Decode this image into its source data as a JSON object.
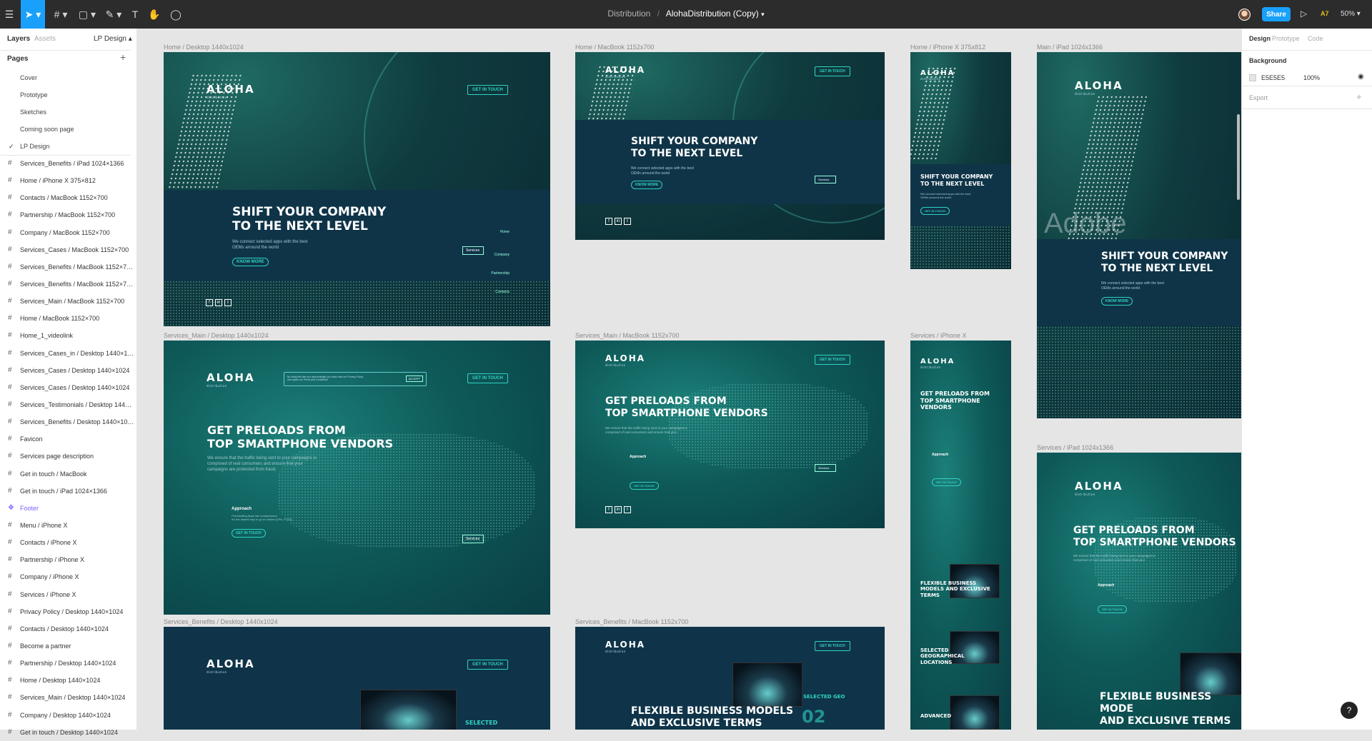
{
  "toolbar": {
    "breadcrumb_project": "Distribution",
    "separator": "/",
    "document_title": "AlohaDistribution (Copy)",
    "share_label": "Share",
    "multiplayer_label": "A7",
    "zoom": "50%"
  },
  "left_panel": {
    "tab_layers": "Layers",
    "tab_assets": "Assets",
    "current_page": "LP Design",
    "pages_heading": "Pages",
    "pages": [
      "Cover",
      "Prototype",
      "Sketches",
      "Coming soon page",
      "LP Design"
    ],
    "layers": [
      "Services_Benefits / iPad 1024×1366",
      "Home / iPhone X 375×812",
      "Contacts / MacBook 1152×700",
      "Partnership / MacBook 1152×700",
      "Company / MacBook 1152×700",
      "Services_Cases / MacBook 1152×700",
      "Services_Benefits / MacBook 1152×7…",
      "Services_Benefits / MacBook 1152×7…",
      "Services_Main / MacBook 1152×700",
      "Home / MacBook 1152×700",
      "Home_1_videolink",
      "Services_Cases_in / Desktop 1440×1…",
      "Services_Cases / Desktop 1440×1024",
      "Services_Cases / Desktop 1440×1024",
      "Services_Testimonials / Desktop 144…",
      "Services_Benefits / Desktop 1440×10…",
      "Favicon",
      "Services page description",
      "Get in touch / MacBook",
      "Get in touch / iPad 1024×1366",
      "Footer",
      "Menu / iPhone X",
      "Contacts / iPhone X",
      "Partnership / iPhone X",
      "Company / iPhone X",
      "Services / iPhone X",
      "Privacy Policy / Desktop 1440×1024",
      "Contacts / Desktop 1440×1024",
      "Become a partner",
      "Partnership  / Desktop 1440×1024",
      "Home / Desktop 1440×1024",
      "Services_Main / Desktop 1440×1024",
      "Company / Desktop 1440×1024",
      "Get in touch / Desktop 1440×1024"
    ]
  },
  "canvas": {
    "frame_labels": {
      "home_desktop": "Home / Desktop 1440x1024",
      "home_macbook": "Home / MacBook 1152x700",
      "home_iphone": "Home / iPhone X 375x812",
      "main_ipad": "Main / iPad 1024x1366",
      "services_main_desktop": "Services_Main / Desktop 1440x1024",
      "services_main_macbook": "Services_Main / MacBook 1152x700",
      "services_iphone": "Services / iPhone X",
      "services_ipad": "Services / iPad 1024x1366",
      "benefits_desktop": "Services_Benefits / Desktop 1440x1024",
      "benefits_macbook": "Services_Benefits / MacBook 1152x700"
    },
    "site": {
      "logo": "ALOHA",
      "logo_sub": "distribution",
      "get_in_touch": "GET IN TOUCH",
      "hero_line1": "SHIFT YOUR COMPANY",
      "hero_line2": "TO THE NEXT LEVEL",
      "hero_sub1": "We connect selected apps with the best",
      "hero_sub2": "OEMs arround the world",
      "know_more": "KNOW MORE",
      "menu": [
        "Home",
        "Services",
        "Company",
        "Partnership",
        "Contacts"
      ],
      "services_line1": "GET PRELOADS FROM",
      "services_line2": "TOP SMARTPHONE VENDORS",
      "services_sub1": "We ensure that the traffic being sent to your campaigns is",
      "services_sub2": "comprised of real consumers and ensure that your",
      "services_sub3": "campaigns are protected from fraud.",
      "approach": "Approach",
      "approach_sub1": "Preinstalling Apps into smartphones.",
      "approach_sub2": "It's the fastest way to go to market (CPA, FOTA)",
      "cookie_text1": "By using this site you acknowledge you have read our Privacy Policy",
      "cookie_text2": "and agree our Terms and Conditions.",
      "accept": "ACCEPT",
      "benefits_line1": "FLEXIBLE BUSINESS MODELS",
      "benefits_line2": "AND EXCLUSIVE TERMS",
      "benefits_ipad1": "FLEXIBLE BUSINESS MODE",
      "benefits_ipad2": "AND EXCLUSIVE TERMS",
      "mob_flexible1": "FLEXIBLE BUSINESS",
      "mob_flexible2": "MODELS AND EXCLUSIVE",
      "mob_flexible3": "TERMS",
      "mob_selected1": "SELECTED",
      "mob_selected2": "GEOGRAPHICAL",
      "mob_selected3": "LOCATIONS",
      "mob_advanced": "ADVANCED",
      "selected": "SELECTED",
      "selected_geo": "SELECTED GEO",
      "num_02": "02",
      "adobe": "Adobe"
    }
  },
  "right_panel": {
    "tab_design": "Design",
    "tab_prototype": "Prototype",
    "tab_code": "Code",
    "background_heading": "Background",
    "bg_hex": "E5E5E5",
    "bg_opacity": "100%",
    "export_heading": "Export"
  },
  "colors": {
    "accent": "#18a0fb",
    "brand_teal": "#2fd3c3",
    "dark_navy": "#0f3448",
    "canvas_bg": "#e5e5e5"
  }
}
